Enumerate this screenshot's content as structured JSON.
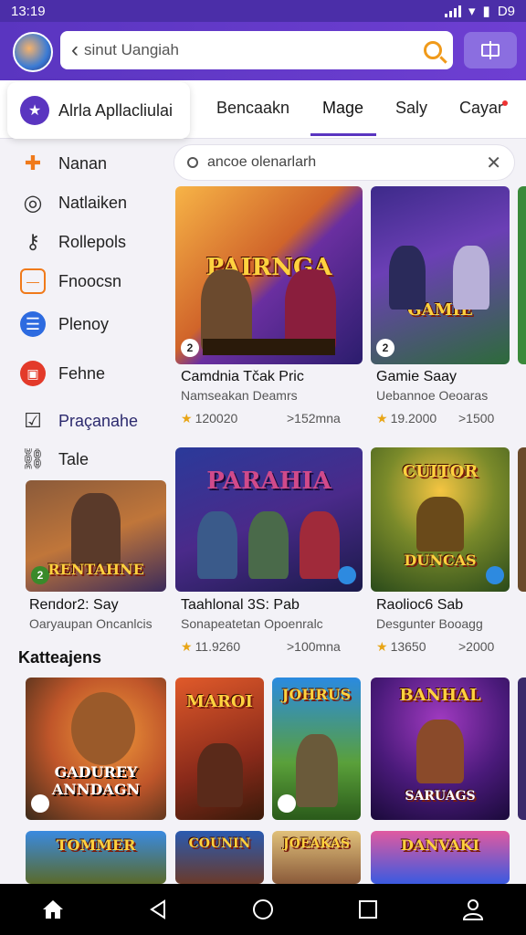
{
  "status_bar": {
    "time": "13:19",
    "right_text": "D9"
  },
  "search": {
    "text": "sinut Uangiah"
  },
  "top_tabs": {
    "app_chip": "Alrla Apllacliulai",
    "tabs": [
      "Bencaakn",
      "Mage",
      "Saly",
      "Cayar"
    ],
    "active_index": 1
  },
  "sidebar": {
    "items": [
      {
        "label": "Nanan",
        "icon": "puzzle-icon",
        "color": "#f07a1a"
      },
      {
        "label": "Natlaiken",
        "icon": "target-icon",
        "color": "#333333"
      },
      {
        "label": "Rollepols",
        "icon": "key-icon",
        "color": "#333333"
      },
      {
        "label": "Fnoocsn",
        "icon": "folder-icon",
        "color": "#f07a1a"
      },
      {
        "label": "Plenoy",
        "icon": "list-icon",
        "color": "#2d6be0"
      },
      {
        "label": "Fehne",
        "icon": "image-icon",
        "color": "#e33a2a"
      },
      {
        "label": "Praçanahe",
        "icon": "check-icon",
        "color": "#333333"
      },
      {
        "label": "Tale",
        "icon": "link-icon",
        "color": "#333333"
      }
    ]
  },
  "filter": {
    "text": "ancoe olenarlarh"
  },
  "cards": [
    {
      "title": "PAIRNGA",
      "badge": "2",
      "name": "Camdnia Tčak Pric",
      "sub": "Namseakan Deamrs",
      "rating": "120020",
      "downloads": ">152mna"
    },
    {
      "title": "GAMIE",
      "badge": "2",
      "name": "Gamie Saay",
      "sub": "Uebannoe Oeoaras",
      "rating": "19.2000",
      "downloads": ">1500"
    },
    {
      "title": "RENTAHNE",
      "badge": "2",
      "name": "Reпdor2: Say",
      "sub": "Oaryaupan Oncanlcis",
      "rating": "",
      "downloads": ""
    },
    {
      "title": "PARAHIA",
      "badge": "",
      "name": "Taahlonal 3S: Pab",
      "sub": "Sonapeatetan Opoenralc",
      "rating": "11.9260",
      "downloads": ">100mna"
    },
    {
      "title": "DUNCAS",
      "badge": "",
      "name": "Raolioc6 Sab",
      "sub": "Desgunter Booagg",
      "rating": "13650",
      "downloads": ">2000"
    }
  ],
  "section": {
    "title": "Katteajens"
  },
  "bottom_cards": [
    {
      "title": "GADUREY ANNDAGN"
    },
    {
      "title": "MAROI"
    },
    {
      "title": "JOHRUS"
    },
    {
      "title": "BANHAL SARUAGS"
    }
  ],
  "bottom_row_cards": [
    {
      "title": "TOMMER"
    },
    {
      "title": "COUNIN"
    },
    {
      "title": "JOEAKAS"
    },
    {
      "title": "DANVAKI"
    }
  ]
}
